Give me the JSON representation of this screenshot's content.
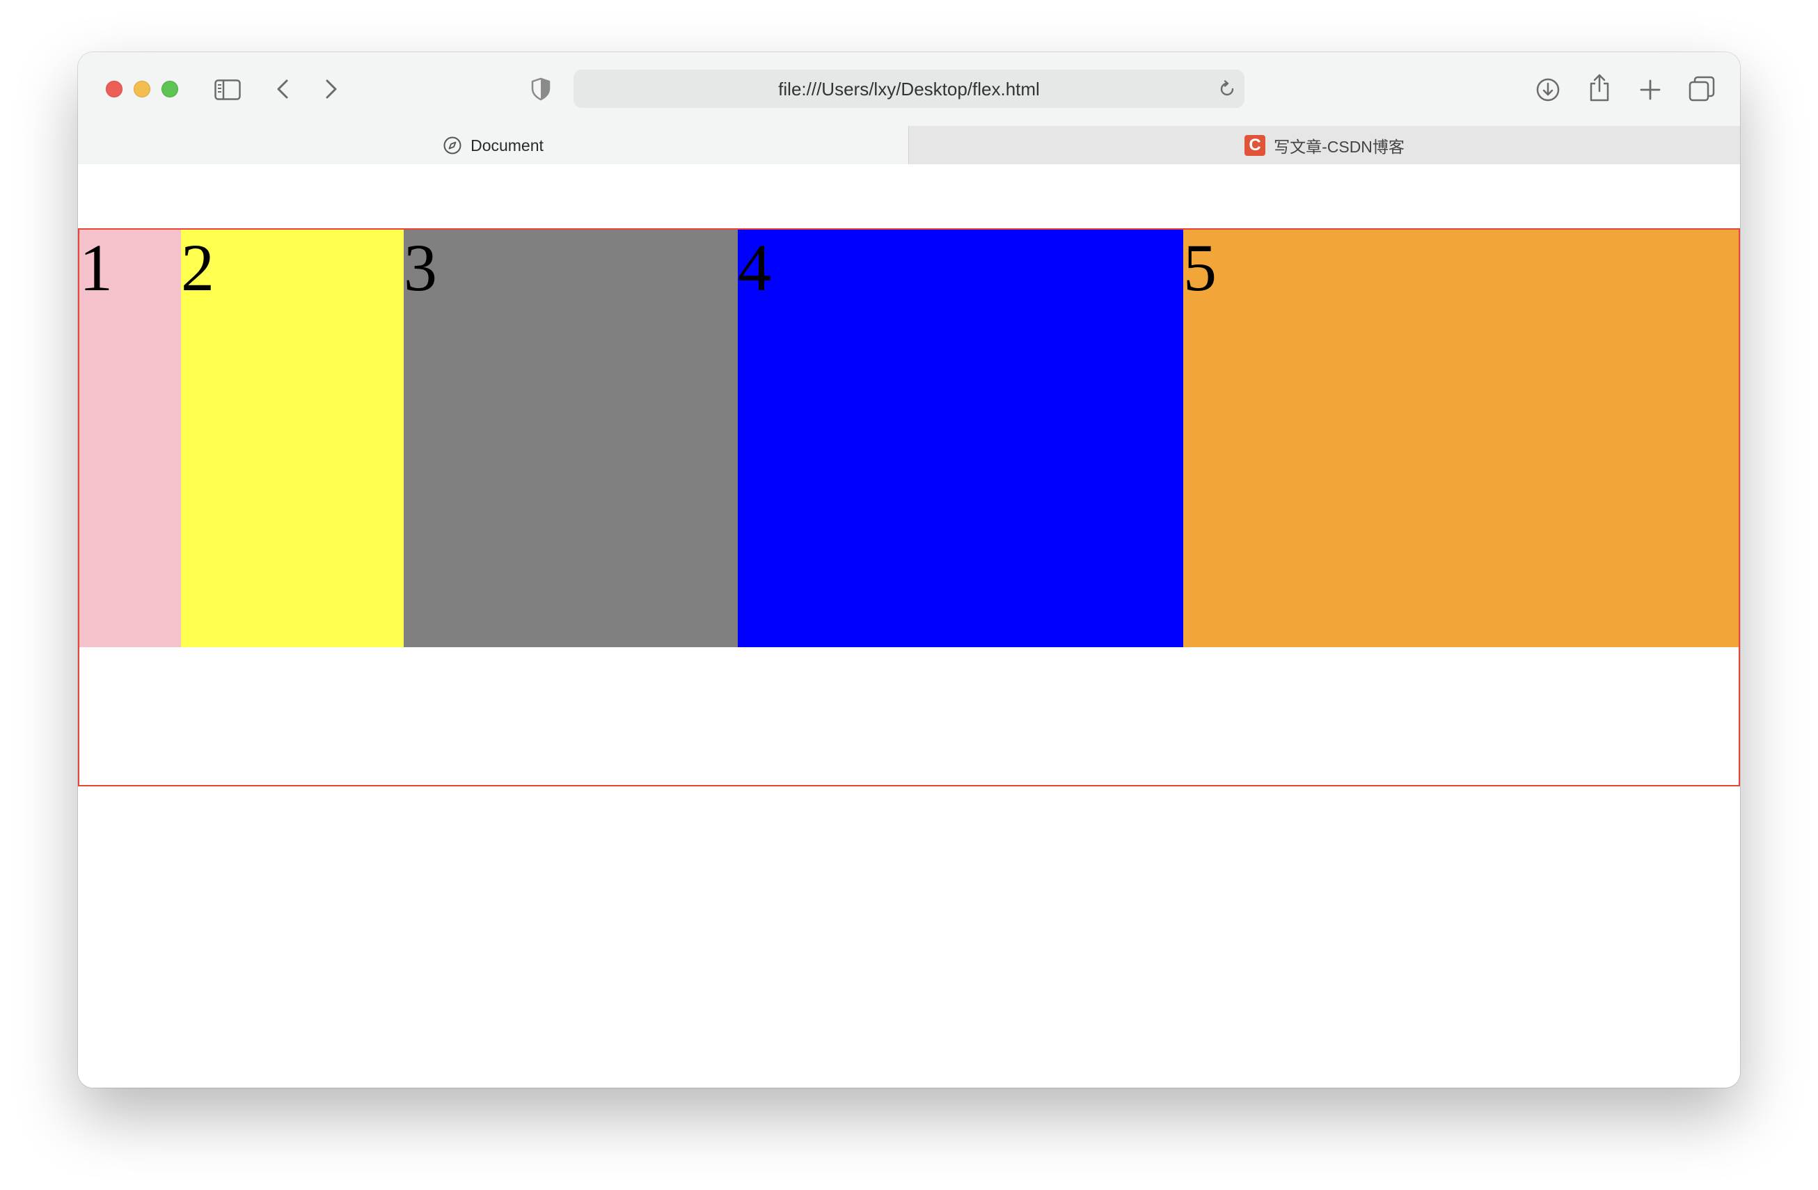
{
  "window": {
    "url": "file:///Users/lxy/Desktop/flex.html"
  },
  "tabs": [
    {
      "label": "Document",
      "active": true,
      "icon": "compass-icon"
    },
    {
      "label": "写文章-CSDN博客",
      "active": false,
      "icon": "csdn-logo-icon",
      "badge_text": "C"
    }
  ],
  "toolbar_icons": [
    "sidebar-icon",
    "back-chevron-icon",
    "forward-chevron-icon",
    "privacy-shield-icon",
    "reload-icon",
    "download-icon",
    "share-icon",
    "new-tab-plus-icon",
    "tab-overview-icon"
  ],
  "page": {
    "container_border_color": "#e8443a",
    "boxes": [
      {
        "label": "1",
        "color": "#f5c2cb"
      },
      {
        "label": "2",
        "color": "#ffff4f"
      },
      {
        "label": "3",
        "color": "#808080"
      },
      {
        "label": "4",
        "color": "#0000ff"
      },
      {
        "label": "5",
        "color": "#f2a63a"
      }
    ]
  }
}
